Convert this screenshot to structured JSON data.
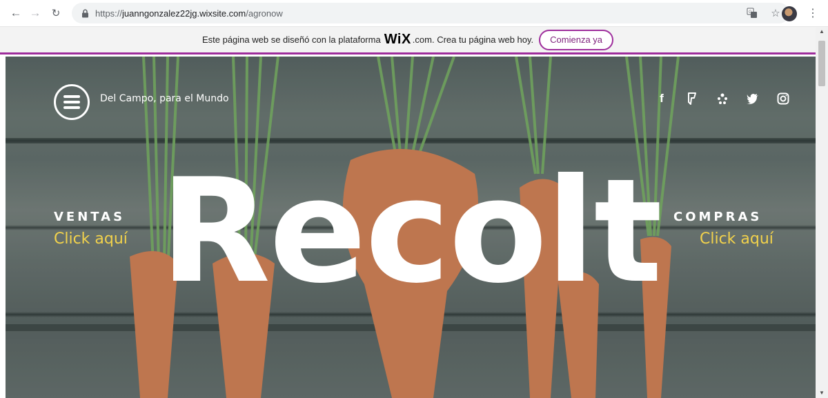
{
  "browser": {
    "url_host": "juanngonzalez22jg.wixsite.com",
    "url_prefix": "https://",
    "url_path": "/agronow",
    "icons": [
      "back-arrow-icon",
      "forward-arrow-icon",
      "reload-icon",
      "lock-icon",
      "translate-icon",
      "bookmark-star-icon",
      "profile-avatar",
      "kebab-menu-icon"
    ]
  },
  "wix_banner": {
    "text_before": "Este página web se diseñó con la plataforma",
    "logo": "WiX",
    "text_after": ".com. Crea tu página web hoy.",
    "button_label": "Comienza ya",
    "accent_color": "#9e2d9c"
  },
  "hero": {
    "tagline": "Del Campo, para el Mundo",
    "title": "Recolt",
    "left_heading": "VENTAS",
    "left_link": "Click aquí",
    "right_heading": "COMPRAS",
    "right_link": "Click aquí",
    "link_color": "#f2d24c",
    "social_icons": [
      "facebook-icon",
      "foursquare-icon",
      "yelp-icon",
      "twitter-icon",
      "instagram-icon"
    ]
  }
}
